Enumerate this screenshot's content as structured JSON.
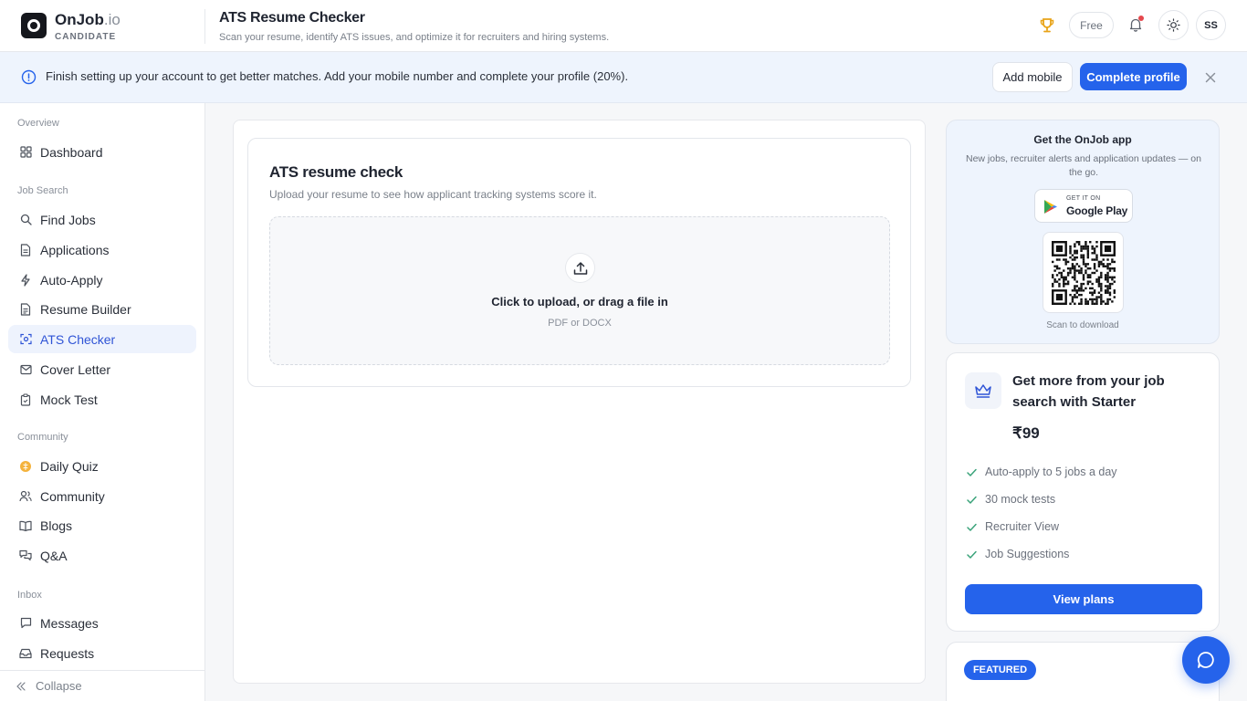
{
  "header": {
    "brand_name": "OnJob",
    "brand_tld": ".io",
    "brand_role": "CANDIDATE",
    "page_title": "ATS Resume Checker",
    "page_subtitle": "Scan your resume, identify ATS issues, and optimize it for recruiters and hiring systems.",
    "plan_badge": "Free",
    "avatar_initials": "SS",
    "top_progress_fraction": 0.2
  },
  "banner": {
    "text": "Finish setting up your account to get better matches. Add your mobile number and complete your profile (20%).",
    "add_mobile_label": "Add mobile",
    "complete_profile_label": "Complete profile"
  },
  "sidebar": {
    "sections": [
      {
        "label": "Overview"
      },
      {
        "label": "Job Search"
      },
      {
        "label": "Community"
      },
      {
        "label": "Inbox"
      }
    ],
    "items": [
      {
        "label": "Dashboard",
        "icon": "grid-icon"
      },
      {
        "label": "Find Jobs",
        "icon": "search-icon"
      },
      {
        "label": "Applications",
        "icon": "file-icon"
      },
      {
        "label": "Auto-Apply",
        "icon": "bolt-icon"
      },
      {
        "label": "Resume Builder",
        "icon": "file-edit-icon"
      },
      {
        "label": "ATS Checker",
        "icon": "scan-icon",
        "active": true
      },
      {
        "label": "Cover Letter",
        "icon": "mail-icon"
      },
      {
        "label": "Mock Test",
        "icon": "clipboard-icon"
      },
      {
        "label": "Daily Quiz",
        "icon": "brain-icon"
      },
      {
        "label": "Community",
        "icon": "users-icon"
      },
      {
        "label": "Blogs",
        "icon": "book-icon"
      },
      {
        "label": "Q&A",
        "icon": "chat-bubbles-icon"
      },
      {
        "label": "Messages",
        "icon": "message-icon"
      },
      {
        "label": "Requests",
        "icon": "inbox-icon"
      }
    ],
    "collapse_label": "Collapse",
    "accent": "#2f54d6"
  },
  "main": {
    "ats_title": "ATS resume check",
    "ats_description": "Upload your resume to see how applicant tracking systems score it.",
    "upload_title": "Click to upload, or drag a file in",
    "upload_hint": "PDF or DOCX"
  },
  "app_promo": {
    "title": "Get the OnJob app",
    "description": "New jobs, recruiter alerts and application updates — on the go.",
    "store_small": "GET IT ON",
    "store_name": "Google Play",
    "qr_label": "Scan to download"
  },
  "plan": {
    "title": "Get more from your job search with Starter",
    "price": "₹99",
    "features": [
      "Auto-apply to 5 jobs a day",
      "30 mock tests",
      "Recruiter View",
      "Job Suggestions"
    ],
    "cta_label": "View plans",
    "primary_color": "#2563eb"
  },
  "featured": {
    "badge": "FEATURED"
  }
}
